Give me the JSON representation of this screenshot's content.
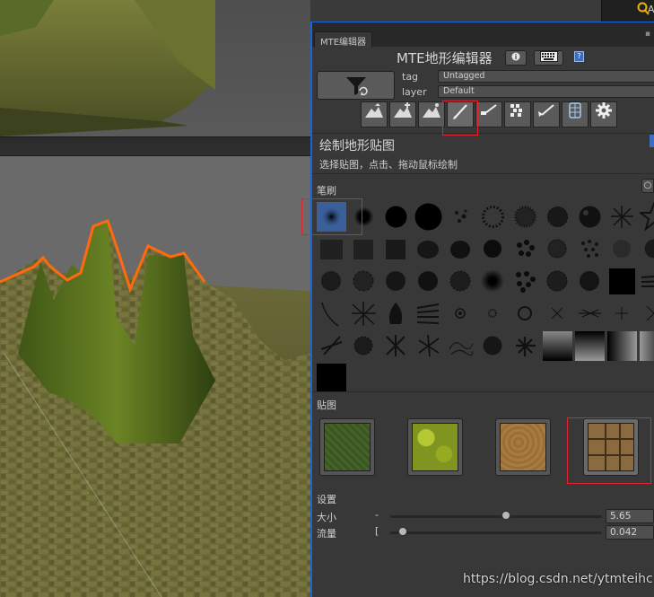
{
  "window": {
    "tab_label": "MTE编辑器",
    "title": "MTE地形编辑器"
  },
  "topbar": {
    "search_icon": "search-icon",
    "partial_label": "A"
  },
  "header": {
    "info_icon": "info-icon",
    "keyboard_icon": "keyboard-icon",
    "help_icon": "help-icon",
    "help_glyph": "?",
    "filter_icon": "filter-refresh-icon",
    "tag_label": "tag",
    "tag_value": "Untagged",
    "layer_label": "layer",
    "layer_value": "Default"
  },
  "tools": [
    {
      "name": "raise-terrain-icon",
      "active": false
    },
    {
      "name": "raise-smooth-icon",
      "active": false
    },
    {
      "name": "flatten-terrain-icon",
      "active": false
    },
    {
      "name": "paint-texture-icon",
      "active": true
    },
    {
      "name": "paint-brush-icon",
      "active": false
    },
    {
      "name": "place-detail-icon",
      "active": false
    },
    {
      "name": "paint-detail-icon",
      "active": false
    },
    {
      "name": "tree-icon",
      "active": false
    },
    {
      "name": "settings-icon",
      "active": false
    }
  ],
  "section": {
    "title": "绘制地形贴图",
    "subtitle": "选择贴图，点击、拖动鼠标绘制",
    "brush_label": "笔刷",
    "texture_label": "贴图",
    "settings_label": "设置"
  },
  "textures": [
    {
      "name": "grass-dark",
      "color": "#3f5a1f"
    },
    {
      "name": "grass-light",
      "color": "#8aa020"
    },
    {
      "name": "sand",
      "color": "#a2783e"
    },
    {
      "name": "cobblestone",
      "color": "#7a5a36",
      "selected": true
    }
  ],
  "settings": {
    "size_label": "大小",
    "size_mark": "-",
    "size_value": "5.65",
    "size_level": 0.55,
    "flow_label": "流量",
    "flow_mark": "[",
    "flow_value": "0.042",
    "flow_level": 0.04
  },
  "watermark": "https://blog.csdn.net/ytmteihc",
  "colors": {
    "accent": "#1b62d6",
    "highlight": "#e0262c",
    "terrain_outline": "#ff6a10"
  }
}
